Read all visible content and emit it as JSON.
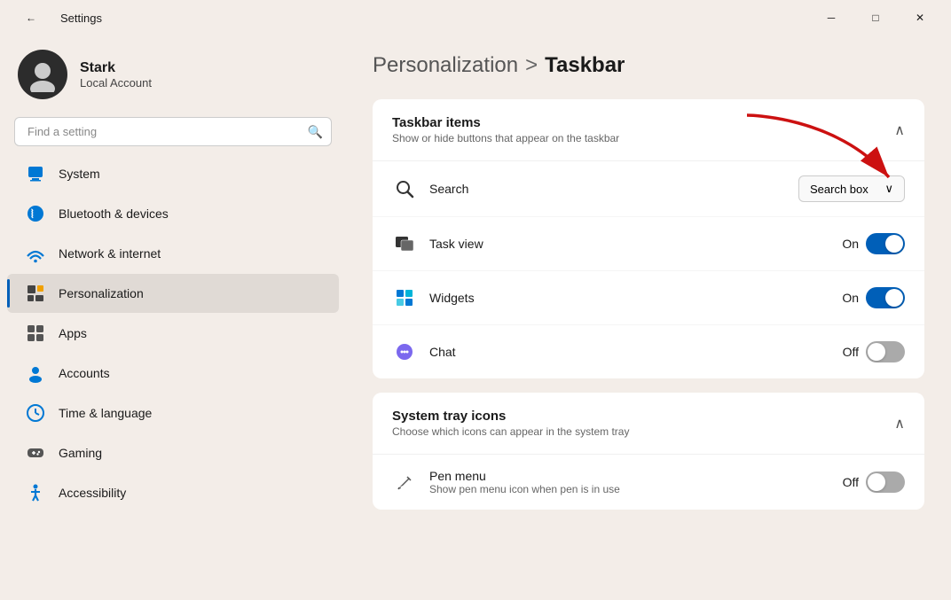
{
  "window": {
    "title": "Settings",
    "controls": {
      "minimize": "─",
      "maximize": "□",
      "close": "✕"
    }
  },
  "sidebar": {
    "back_icon": "←",
    "user": {
      "name": "Stark",
      "account_type": "Local Account"
    },
    "search_placeholder": "Find a setting",
    "nav_items": [
      {
        "id": "system",
        "label": "System",
        "icon": "system"
      },
      {
        "id": "bluetooth",
        "label": "Bluetooth & devices",
        "icon": "bluetooth"
      },
      {
        "id": "network",
        "label": "Network & internet",
        "icon": "network"
      },
      {
        "id": "personalization",
        "label": "Personalization",
        "icon": "personalization",
        "active": true
      },
      {
        "id": "apps",
        "label": "Apps",
        "icon": "apps"
      },
      {
        "id": "accounts",
        "label": "Accounts",
        "icon": "accounts"
      },
      {
        "id": "time",
        "label": "Time & language",
        "icon": "time"
      },
      {
        "id": "gaming",
        "label": "Gaming",
        "icon": "gaming"
      },
      {
        "id": "accessibility",
        "label": "Accessibility",
        "icon": "accessibility"
      }
    ]
  },
  "content": {
    "breadcrumb_parent": "Personalization",
    "breadcrumb_separator": ">",
    "breadcrumb_current": "Taskbar",
    "sections": [
      {
        "id": "taskbar-items",
        "title": "Taskbar items",
        "subtitle": "Show or hide buttons that appear on the taskbar",
        "expanded": true,
        "items": [
          {
            "id": "search",
            "label": "Search",
            "icon": "search",
            "control_type": "dropdown",
            "value": "Search box"
          },
          {
            "id": "task-view",
            "label": "Task view",
            "icon": "taskview",
            "control_type": "toggle",
            "value": "On",
            "state": "on"
          },
          {
            "id": "widgets",
            "label": "Widgets",
            "icon": "widgets",
            "control_type": "toggle",
            "value": "On",
            "state": "on"
          },
          {
            "id": "chat",
            "label": "Chat",
            "icon": "chat",
            "control_type": "toggle",
            "value": "Off",
            "state": "off"
          }
        ]
      },
      {
        "id": "system-tray",
        "title": "System tray icons",
        "subtitle": "Choose which icons can appear in the system tray",
        "expanded": true,
        "items": [
          {
            "id": "pen-menu",
            "label": "Pen menu",
            "sublabel": "Show pen menu icon when pen is in use",
            "icon": "pen",
            "control_type": "toggle",
            "value": "Off",
            "state": "off"
          }
        ]
      }
    ]
  },
  "colors": {
    "accent": "#005fb8",
    "toggle_on": "#005fb8",
    "toggle_off": "#aaaaaa",
    "active_nav_indicator": "#005fb8",
    "sidebar_bg": "#f3ede8",
    "card_bg": "#ffffff"
  }
}
